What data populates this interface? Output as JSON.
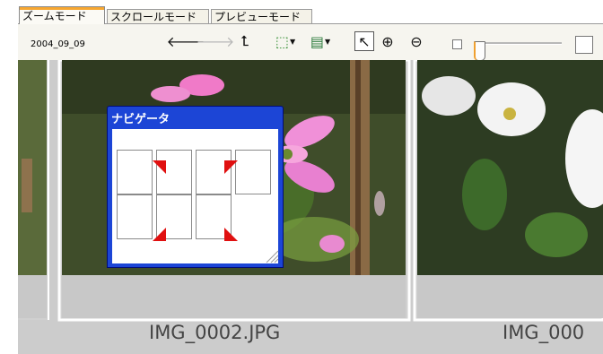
{
  "tabs": [
    {
      "label": "ズームモード",
      "active": true
    },
    {
      "label": "スクロールモード",
      "active": false
    },
    {
      "label": "プレビューモード",
      "active": false
    }
  ],
  "toolbar": {
    "folder_label": "2004_09_09",
    "buttons": [
      {
        "name": "back-arrow-icon",
        "glyph": "🡐",
        "enabled": true
      },
      {
        "name": "forward-arrow-icon",
        "glyph": "🡒",
        "enabled": false
      },
      {
        "name": "up-arrow-icon",
        "glyph": "⮤",
        "enabled": true
      },
      {
        "name": "select-mode-icon",
        "glyph": "⬚",
        "enabled": true
      },
      {
        "name": "display-mode-icon",
        "glyph": "▤",
        "enabled": true
      },
      {
        "name": "pointer-icon",
        "glyph": "↖",
        "enabled": true
      },
      {
        "name": "zoom-in-icon",
        "glyph": "⊕",
        "enabled": true
      },
      {
        "name": "zoom-out-icon",
        "glyph": "⊖",
        "enabled": true
      }
    ],
    "zoom_slider_level": 0.05
  },
  "images": [
    {
      "caption": "IMG_0002.JPG"
    },
    {
      "caption": "IMG_000"
    }
  ],
  "navigator": {
    "title": "ナビゲータ"
  },
  "colors": {
    "tab_accent": "#f7a731",
    "navigator_frame": "#1c45d6",
    "navigator_marker": "#e01010",
    "viewer_background": "#cccccc"
  }
}
